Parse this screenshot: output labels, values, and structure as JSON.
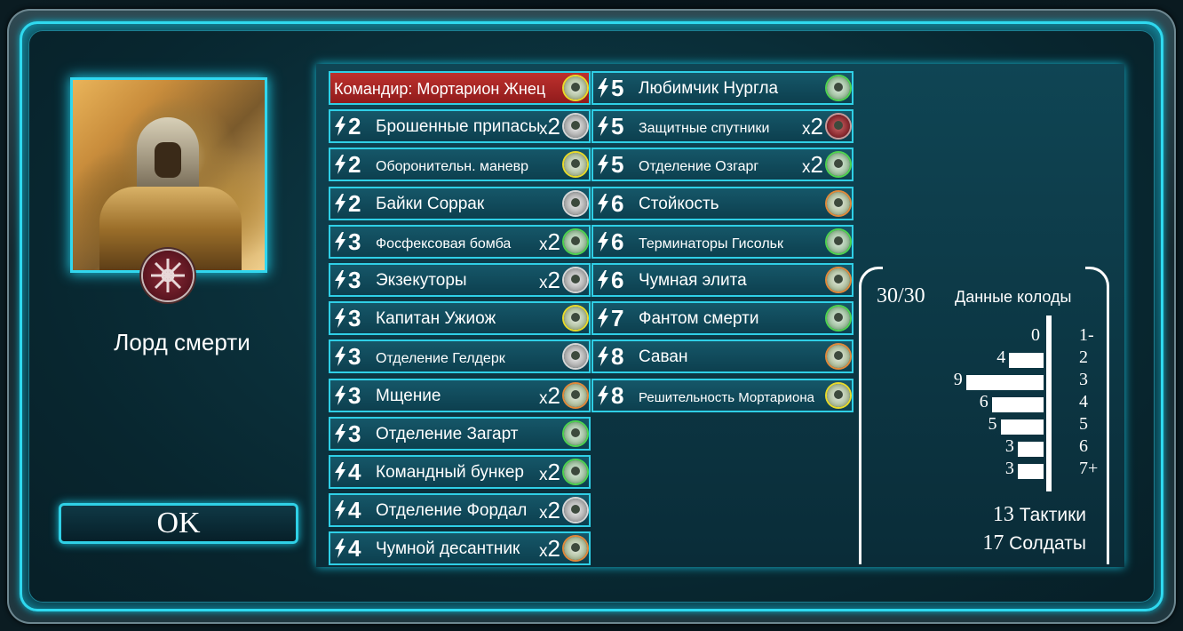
{
  "hero": {
    "name": "Лорд смерти",
    "portrait_icon": "mortarion-portrait",
    "faction_icon": "chaos-star-icon"
  },
  "ok_button": {
    "label": "OK"
  },
  "deck": {
    "cards_left": [
      {
        "commander": true,
        "name": "Командир: Мортарион Жнец",
        "cost": "",
        "count": "",
        "faction": "yellow"
      },
      {
        "cost": "2",
        "name": "Брошенные припасы",
        "count": "2",
        "faction": "gray"
      },
      {
        "cost": "2",
        "name": "Оборонительн. маневр",
        "count": "",
        "faction": "yellow",
        "small": true
      },
      {
        "cost": "2",
        "name": "Байки Соррак",
        "count": "",
        "faction": "gray"
      },
      {
        "cost": "3",
        "name": "Фосфексовая бомба",
        "count": "2",
        "faction": "green",
        "small": true
      },
      {
        "cost": "3",
        "name": "Экзекуторы",
        "count": "2",
        "faction": "gray"
      },
      {
        "cost": "3",
        "name": "Капитан Ужиож",
        "count": "",
        "faction": "yellow"
      },
      {
        "cost": "3",
        "name": "Отделение Гелдерк",
        "count": "",
        "faction": "gray",
        "small": true
      },
      {
        "cost": "3",
        "name": "Мщение",
        "count": "2",
        "faction": "orange"
      },
      {
        "cost": "3",
        "name": "Отделение Загарт",
        "count": "",
        "faction": "green"
      },
      {
        "cost": "4",
        "name": "Командный бункер",
        "count": "2",
        "faction": "green"
      },
      {
        "cost": "4",
        "name": "Отделение Фордал",
        "count": "2",
        "faction": "gray"
      },
      {
        "cost": "4",
        "name": "Чумной десантник",
        "count": "2",
        "faction": "orange"
      }
    ],
    "cards_right": [
      {
        "cost": "5",
        "name": "Любимчик Нургла",
        "count": "",
        "faction": "green"
      },
      {
        "cost": "5",
        "name": "Защитные спутники",
        "count": "2",
        "faction": "chaos",
        "small": true
      },
      {
        "cost": "5",
        "name": "Отделение Озгарг",
        "count": "2",
        "faction": "green",
        "small": true
      },
      {
        "cost": "6",
        "name": "Стойкость",
        "count": "",
        "faction": "orange"
      },
      {
        "cost": "6",
        "name": "Терминаторы Гисольк",
        "count": "",
        "faction": "green",
        "small": true
      },
      {
        "cost": "6",
        "name": "Чумная элита",
        "count": "",
        "faction": "orange"
      },
      {
        "cost": "7",
        "name": "Фантом смерти",
        "count": "",
        "faction": "green"
      },
      {
        "cost": "8",
        "name": "Саван",
        "count": "",
        "faction": "orange"
      },
      {
        "cost": "8",
        "name": "Решительность Мортариона",
        "count": "",
        "faction": "yellow",
        "xsmall": true
      }
    ]
  },
  "stats": {
    "deck_count": "30/30",
    "title": "Данные колоды",
    "tactics_count": "13",
    "tactics_label": "Тактики",
    "soldiers_count": "17",
    "soldiers_label": "Солдаты"
  },
  "chart_data": {
    "type": "bar",
    "orientation": "horizontal",
    "categories": [
      "1-",
      "2",
      "3",
      "4",
      "5",
      "6",
      "7+"
    ],
    "values": [
      0,
      4,
      9,
      6,
      5,
      3,
      3
    ]
  },
  "colors": {
    "frame_glow": "#2fd9ef",
    "commander_card": "#b02a28",
    "card_bg": "#16586a"
  }
}
